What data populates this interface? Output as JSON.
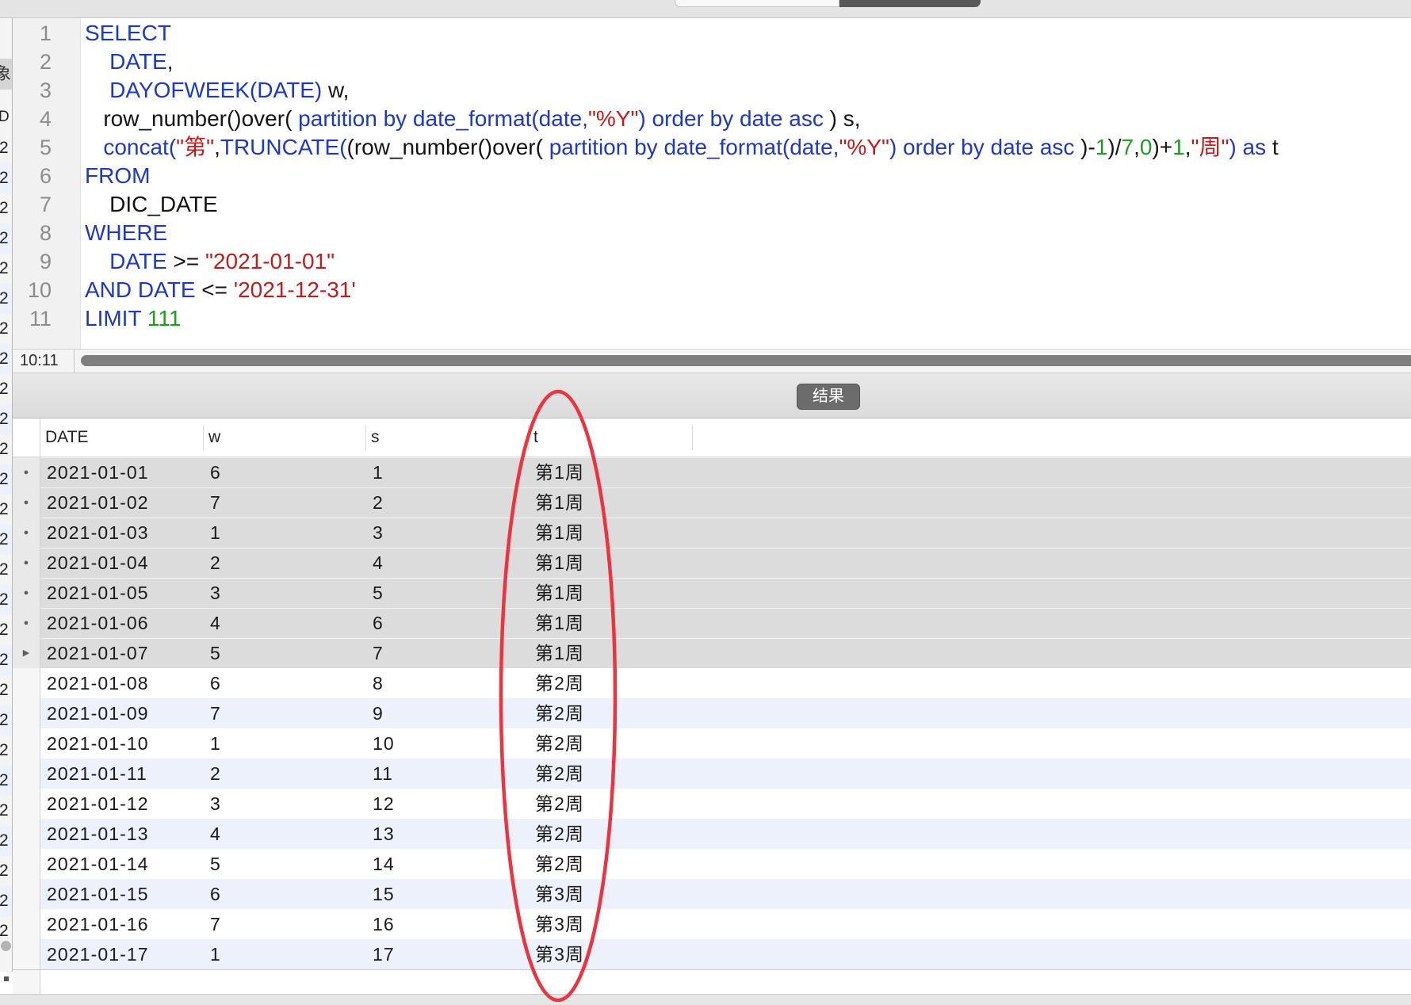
{
  "colors": {
    "keyword": "#1f38c6",
    "string": "#c21c1c",
    "number": "#1e9e1e",
    "text": "#141414",
    "line_number": "#8c8c8c",
    "annotation": "#ec3340",
    "selected_row": "#dcdcdc",
    "striped_row": "#edf1fb",
    "tab_button": "#6c6c6c"
  },
  "sidebar": {
    "header": "象",
    "column": "D",
    "items": [
      "2",
      "2",
      "2",
      "2",
      "2",
      "2",
      "2",
      "2",
      "2",
      "2",
      "2",
      "2",
      "2",
      "2",
      "2",
      "2",
      "2",
      "2",
      "2",
      "2",
      "2",
      "2",
      "2",
      "2",
      "2",
      "2",
      "2"
    ]
  },
  "editor": {
    "lines": [
      {
        "n": "1",
        "tokens": [
          {
            "kw": "SELECT"
          }
        ]
      },
      {
        "n": "2",
        "tokens": [
          {
            "kw": "    DATE"
          },
          {
            "txt": ","
          }
        ]
      },
      {
        "n": "3",
        "tokens": [
          {
            "kw": "    DAYOFWEEK(DATE)"
          },
          {
            "txt": " w,"
          }
        ]
      },
      {
        "n": "4",
        "tokens": [
          {
            "txt": "   row_number()over("
          },
          {
            "kw": " partition by date_format(date,"
          },
          {
            "str": "\"%Y\""
          },
          {
            "kw": ") order by date asc"
          },
          {
            "txt": " ) s,"
          }
        ]
      },
      {
        "n": "5",
        "tokens": [
          {
            "kw": "   concat("
          },
          {
            "str": "\"第\""
          },
          {
            "txt": ","
          },
          {
            "kw": "TRUNCATE("
          },
          {
            "txt": "(row_number()over("
          },
          {
            "kw": " partition by date_format(date,"
          },
          {
            "str": "\"%Y\""
          },
          {
            "kw": ") order by date asc"
          },
          {
            "txt": " )-"
          },
          {
            "num": "1"
          },
          {
            "txt": ")/"
          },
          {
            "num": "7"
          },
          {
            "txt": ","
          },
          {
            "num": "0"
          },
          {
            "txt": ")+"
          },
          {
            "num": "1"
          },
          {
            "txt": ","
          },
          {
            "str": "\"周\""
          },
          {
            "kw": ") as"
          },
          {
            "txt": " t"
          }
        ]
      },
      {
        "n": "6",
        "tokens": [
          {
            "kw": "FROM"
          }
        ]
      },
      {
        "n": "7",
        "tokens": [
          {
            "txt": "    DIC_DATE"
          }
        ]
      },
      {
        "n": "8",
        "tokens": [
          {
            "kw": "WHERE"
          }
        ]
      },
      {
        "n": "9",
        "tokens": [
          {
            "kw": "    DATE"
          },
          {
            "txt": " >= "
          },
          {
            "str": "\"2021-01-01\""
          }
        ]
      },
      {
        "n": "10",
        "tokens": [
          {
            "kw": "AND DATE"
          },
          {
            "txt": " <= "
          },
          {
            "str": "'2021-12-31'"
          }
        ]
      },
      {
        "n": "11",
        "tokens": [
          {
            "kw": "LIMIT "
          },
          {
            "num": "111"
          }
        ]
      }
    ]
  },
  "status": {
    "cursor": "10:11"
  },
  "results": {
    "tab_label": "结果",
    "columns": [
      "DATE",
      "w",
      "s",
      "t"
    ],
    "rows": [
      {
        "marker_icon": "dot-icon",
        "selected": true,
        "cells": [
          "2021-01-01",
          "6",
          "1",
          "第1周"
        ]
      },
      {
        "marker_icon": "dot-icon",
        "selected": true,
        "cells": [
          "2021-01-02",
          "7",
          "2",
          "第1周"
        ]
      },
      {
        "marker_icon": "dot-icon",
        "selected": true,
        "cells": [
          "2021-01-03",
          "1",
          "3",
          "第1周"
        ]
      },
      {
        "marker_icon": "dot-icon",
        "selected": true,
        "cells": [
          "2021-01-04",
          "2",
          "4",
          "第1周"
        ]
      },
      {
        "marker_icon": "dot-icon",
        "selected": true,
        "cells": [
          "2021-01-05",
          "3",
          "5",
          "第1周"
        ]
      },
      {
        "marker_icon": "dot-icon",
        "selected": true,
        "cells": [
          "2021-01-06",
          "4",
          "6",
          "第1周"
        ]
      },
      {
        "marker_icon": "arrow-icon",
        "selected": true,
        "cells": [
          "2021-01-07",
          "5",
          "7",
          "第1周"
        ]
      },
      {
        "selected": false,
        "cells": [
          "2021-01-08",
          "6",
          "8",
          "第2周"
        ]
      },
      {
        "selected": false,
        "cells": [
          "2021-01-09",
          "7",
          "9",
          "第2周"
        ]
      },
      {
        "selected": false,
        "cells": [
          "2021-01-10",
          "1",
          "10",
          "第2周"
        ]
      },
      {
        "selected": false,
        "cells": [
          "2021-01-11",
          "2",
          "11",
          "第2周"
        ]
      },
      {
        "selected": false,
        "cells": [
          "2021-01-12",
          "3",
          "12",
          "第2周"
        ]
      },
      {
        "selected": false,
        "cells": [
          "2021-01-13",
          "4",
          "13",
          "第2周"
        ]
      },
      {
        "selected": false,
        "cells": [
          "2021-01-14",
          "5",
          "14",
          "第2周"
        ]
      },
      {
        "selected": false,
        "cells": [
          "2021-01-15",
          "6",
          "15",
          "第3周"
        ]
      },
      {
        "selected": false,
        "cells": [
          "2021-01-16",
          "7",
          "16",
          "第3周"
        ]
      },
      {
        "selected": false,
        "cells": [
          "2021-01-17",
          "1",
          "17",
          "第3周"
        ]
      }
    ]
  }
}
